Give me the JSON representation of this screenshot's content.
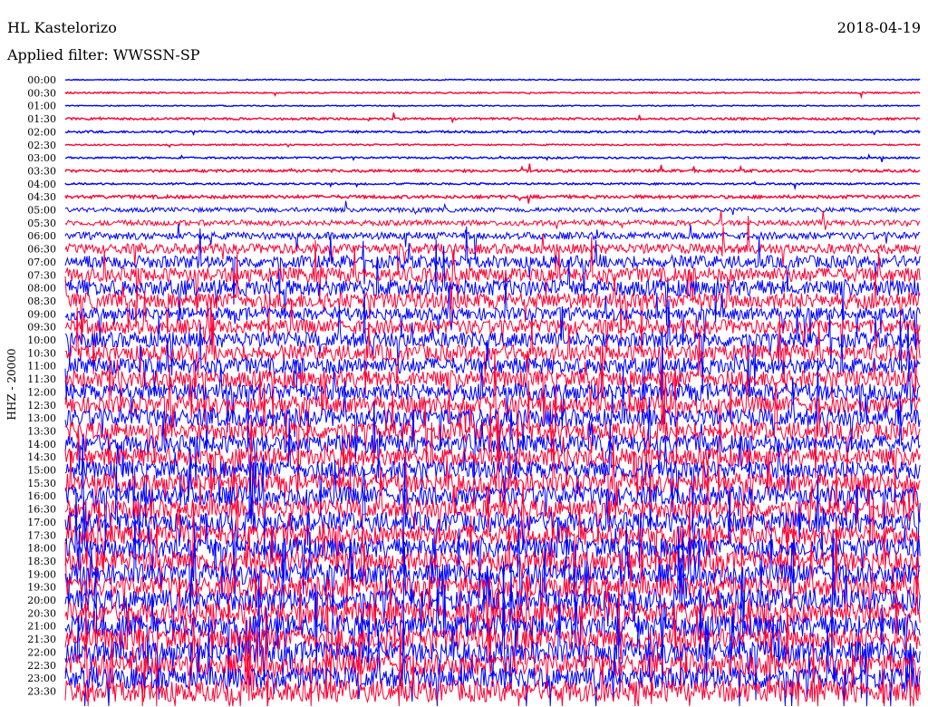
{
  "header": {
    "station": "HL Kastelorizo",
    "date": "2018-04-19",
    "filter": "Applied filter: WWSSN-SP"
  },
  "chart_data": {
    "type": "line",
    "title": "HL Kastelorizo",
    "ylabel": "HHZ - 20000",
    "row_labels": [
      "00:00",
      "00:30",
      "01:00",
      "01:30",
      "02:00",
      "02:30",
      "03:00",
      "03:30",
      "04:00",
      "04:30",
      "05:00",
      "05:30",
      "06:00",
      "06:30",
      "07:00",
      "07:30",
      "08:00",
      "08:30",
      "09:00",
      "09:30",
      "10:00",
      "10:30",
      "11:00",
      "11:30",
      "12:00",
      "12:30",
      "13:00",
      "13:30",
      "14:00",
      "14:30",
      "15:00",
      "15:30",
      "16:00",
      "16:30",
      "17:00",
      "17:30",
      "18:00",
      "18:30",
      "19:00",
      "19:30",
      "20:00",
      "20:30",
      "21:00",
      "21:30",
      "22:00",
      "22:30",
      "23:00",
      "23:30"
    ],
    "row_colors": [
      "#0000ff",
      "#ff0033"
    ],
    "noise_amplitude_by_row": [
      0.6,
      0.8,
      0.6,
      1.2,
      1.2,
      0.8,
      1.0,
      1.5,
      1.0,
      1.8,
      2.5,
      3.0,
      4.0,
      5.5,
      7.0,
      8.0,
      9.0,
      9.0,
      7.0,
      8.0,
      8.5,
      9.0,
      9.0,
      9.5,
      9.5,
      9.5,
      10.0,
      10.0,
      10.0,
      10.0,
      10.0,
      10.5,
      10.5,
      10.5,
      11.0,
      11.0,
      11.0,
      11.5,
      11.5,
      11.5,
      12.0,
      12.0,
      12.0,
      12.0,
      12.0,
      12.0,
      12.0,
      12.0
    ],
    "time_span_minutes_per_row": 30,
    "grid": false,
    "legend": "none"
  }
}
